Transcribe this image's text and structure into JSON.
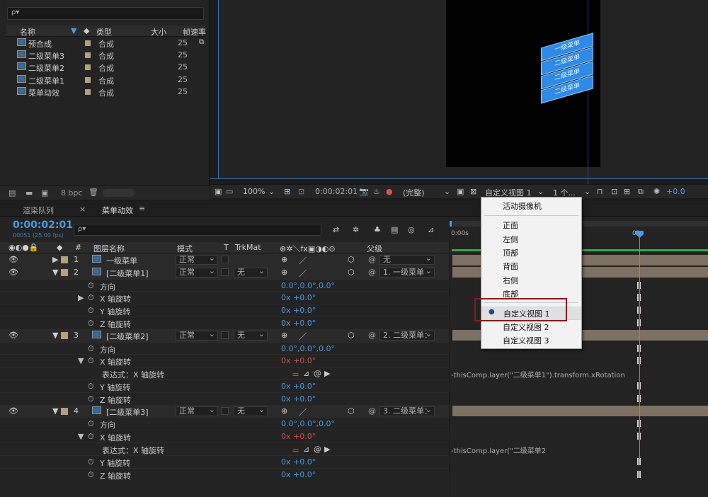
{
  "project": {
    "search_placeholder": "ρ▾",
    "columns": {
      "name": "名称",
      "type": "类型",
      "size": "大小",
      "fps": "帧速率"
    },
    "items": [
      {
        "name": "预合成",
        "type": "合成",
        "fps": "25"
      },
      {
        "name": "二级菜单3",
        "type": "合成",
        "fps": "25"
      },
      {
        "name": "二级菜单2",
        "type": "合成",
        "fps": "25"
      },
      {
        "name": "二级菜单1",
        "type": "合成",
        "fps": "25"
      },
      {
        "name": "菜单动效",
        "type": "合成",
        "fps": "25"
      }
    ],
    "bpc": "8 bpc"
  },
  "viewer": {
    "zoom": "100%",
    "timecode": "0:00:02:01",
    "resolution": "(完整)",
    "view": "自定义视图 1",
    "views_count": "1 个...",
    "exposure": "+0.0",
    "cards": [
      "一级菜单",
      "二级菜单",
      "二级菜单",
      "二级菜单"
    ]
  },
  "timeline": {
    "render_queue_tab": "渲染队列",
    "comp_tab": "菜单动效",
    "current_time": "0:00:02:01",
    "frame_info": "00051 (25.00 fps)",
    "search_placeholder": "ρ▾",
    "headers": {
      "layer_name": "图层名称",
      "mode": "模式",
      "t": "T",
      "trkmat": "TrkMat",
      "parent": "父级"
    },
    "ruler": {
      "start": "0:00s",
      "mark": "02"
    },
    "rows": [
      {
        "kind": "layer",
        "num": "1",
        "name": "一级菜单",
        "mode": "正常",
        "trk": "",
        "parent": "无"
      },
      {
        "kind": "layer",
        "num": "2",
        "name": "[二级菜单1]",
        "mode": "正常",
        "trk": "无",
        "parent": "1. 一级菜单"
      },
      {
        "kind": "prop",
        "name": "方向",
        "value": "0.0°,0.0°,0.0°"
      },
      {
        "kind": "prop",
        "name": "X 轴旋转",
        "value": "0x +0.0°"
      },
      {
        "kind": "prop",
        "name": "Y 轴旋转",
        "value": "0x +0.0°"
      },
      {
        "kind": "prop",
        "name": "Z 轴旋转",
        "value": "0x +0.0°"
      },
      {
        "kind": "layer",
        "num": "3",
        "name": "[二级菜单2]",
        "mode": "正常",
        "trk": "无",
        "parent": "2. 二级菜单："
      },
      {
        "kind": "prop",
        "name": "方向",
        "value": "0.0°,0.0°,0.0°"
      },
      {
        "kind": "prop",
        "name": "X 轴旋转",
        "value": "0x +0.0°"
      },
      {
        "kind": "expr",
        "name": "表达式：X 轴旋转",
        "expr": "-thisComp.layer(\"二级菜单1\").transform.xRotation"
      },
      {
        "kind": "prop",
        "name": "Y 轴旋转",
        "value": "0x +0.0°"
      },
      {
        "kind": "prop",
        "name": "Z 轴旋转",
        "value": "0x +0.0°"
      },
      {
        "kind": "layer",
        "num": "4",
        "name": "[二级菜单3]",
        "mode": "正常",
        "trk": "无",
        "parent": "3. 二级菜单："
      },
      {
        "kind": "prop",
        "name": "方向",
        "value": "0.0°,0.0°,0.0°"
      },
      {
        "kind": "prop",
        "name": "X 轴旋转",
        "value": "0x +0.0°"
      },
      {
        "kind": "expr",
        "name": "表达式：X 轴旋转",
        "expr": "-thisComp.layer(\"二级菜单2"
      },
      {
        "kind": "prop",
        "name": "Y 轴旋转",
        "value": "0x +0.0°"
      },
      {
        "kind": "prop",
        "name": "Z 轴旋转",
        "value": "0x +0.0°"
      }
    ]
  },
  "view_menu": {
    "items": [
      "活动摄像机",
      "正面",
      "左侧",
      "顶部",
      "背面",
      "右侧",
      "底部",
      "自定义视图 1",
      "自定义视图 2",
      "自定义视图 3"
    ],
    "selected": "自定义视图 1"
  },
  "colors": {
    "accent": "#2d8ae6",
    "timecode": "#4a9bdf",
    "highlight_border": "#8a1a1a",
    "label": "#b5a07c"
  }
}
